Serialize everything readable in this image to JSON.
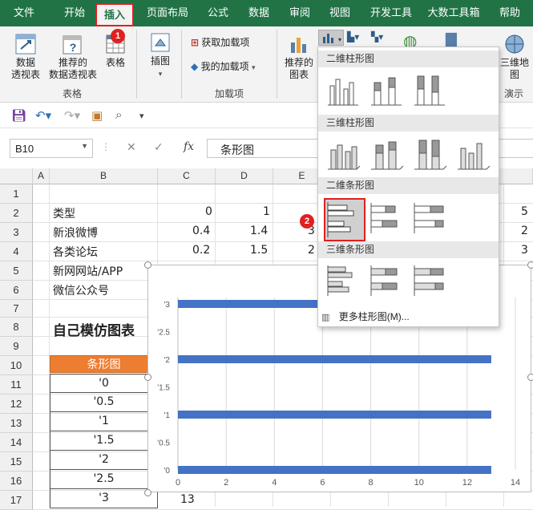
{
  "ribbon_tabs": [
    "文件",
    "开始",
    "插入",
    "页面布局",
    "公式",
    "数据",
    "审阅",
    "视图",
    "开发工具",
    "大数工具箱",
    "帮助"
  ],
  "active_tab": "插入",
  "badges": {
    "one": "1",
    "two": "2"
  },
  "ribbon": {
    "pivot_table": "数据\n透视表",
    "pivot_table_l1": "数据",
    "pivot_table_l2": "透视表",
    "recommended_pivot_l1": "推荐的",
    "recommended_pivot_l2": "数据透视表",
    "table": "表格",
    "group_tables": "表格",
    "illustrations": "插图",
    "get_addins": "获取加载项",
    "my_addins": "我的加载项",
    "group_addins": "加载项",
    "recommended_charts_l1": "推荐的",
    "recommended_charts_l2": "图表",
    "three_d_map_l1": "三维地",
    "three_d_map_l2": "图",
    "group_tours": "演示"
  },
  "formula_bar": {
    "name_box": "B10",
    "fx": "fx",
    "content": "条形图"
  },
  "columns": [
    "A",
    "B",
    "C",
    "D",
    "E"
  ],
  "rows": [
    "1",
    "2",
    "3",
    "4",
    "5",
    "6",
    "7",
    "8",
    "9",
    "10",
    "11",
    "12",
    "13",
    "14",
    "15",
    "16",
    "17"
  ],
  "sheet": {
    "b2": "类型",
    "c2": "0",
    "d2": "1",
    "b3": "新浪微博",
    "c3": "0.4",
    "d3": "1.4",
    "e3": "3",
    "b4": "各类论坛",
    "c4": "0.2",
    "d4": "1.5",
    "e4": "2",
    "b5": "新网网站/APP",
    "b6": "微信公众号",
    "b8": "自己模仿图表",
    "b10": "条形图",
    "list": [
      "'0",
      "'0.5",
      "'1",
      "'1.5",
      "'2",
      "'2.5",
      "'3"
    ],
    "c17": "13",
    "right_partial": [
      "5",
      "2",
      "3"
    ]
  },
  "dropdown": {
    "sections": [
      "二维柱形图",
      "三维柱形图",
      "二维条形图",
      "三维条形图"
    ],
    "more": "更多柱形图(M)..."
  },
  "chart_data": {
    "type": "bar",
    "orientation": "horizontal",
    "categories": [
      "'0",
      "'0.5",
      "'1",
      "'1.5",
      "'2",
      "'2.5",
      "'3"
    ],
    "values": [
      13,
      null,
      13,
      null,
      13,
      null,
      13
    ],
    "xlim": [
      0,
      14
    ],
    "xticks": [
      "0",
      "2",
      "4",
      "6",
      "8",
      "10",
      "12",
      "14"
    ],
    "grid": true,
    "bar_color": "#4472c4"
  },
  "colors": {
    "accent": "#217346",
    "highlight": "#e02020",
    "header_fill": "#ed7d31"
  }
}
